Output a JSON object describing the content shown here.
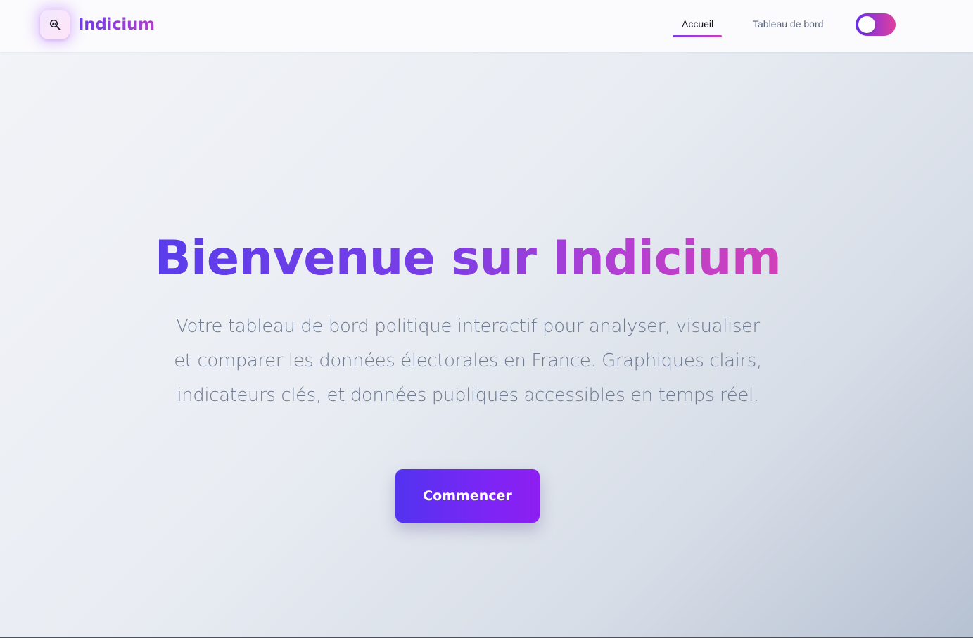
{
  "header": {
    "brand_name": "Indicium",
    "logo_icon": "chart-search-icon",
    "nav": [
      {
        "label": "Accueil",
        "active": true
      },
      {
        "label": "Tableau de bord",
        "active": false
      }
    ],
    "theme_toggle": {
      "icon": "toggle-switch",
      "on": false
    }
  },
  "hero": {
    "title": "Bienvenue sur Indicium",
    "subtitle": "Votre tableau de bord politique interactif pour analyser, visualiser et comparer les données électorales en France. Graphiques clairs, indicateurs clés, et données publiques accessibles en temps réel.",
    "cta_label": "Commencer"
  },
  "colors": {
    "accent_start": "#5233f0",
    "accent_end": "#8e1ef2",
    "brand_pink": "#d040b8",
    "subtitle_text": "#6f7b92"
  }
}
